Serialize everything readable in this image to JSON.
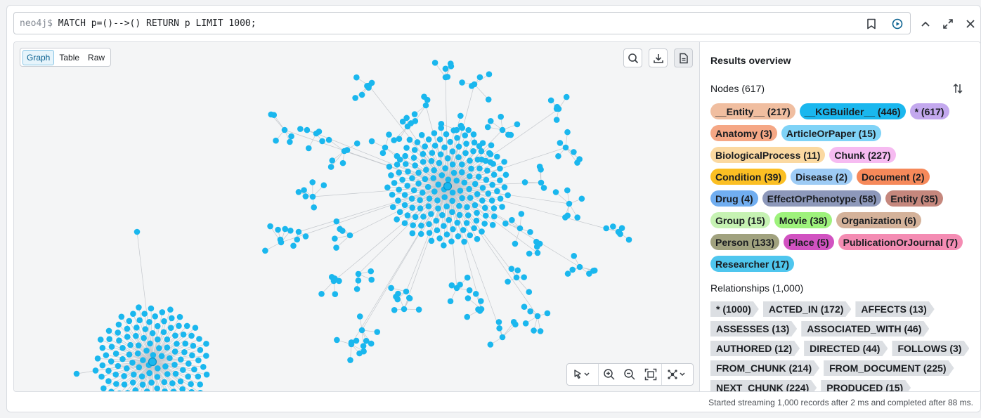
{
  "query": {
    "prompt": "neo4j$",
    "text": "MATCH p=()-->() RETURN p LIMIT 1000;"
  },
  "icons": {
    "bookmark": "bookmark-icon",
    "run": "run-icon",
    "collapse": "chevron-up-icon",
    "expand": "fullscreen-icon",
    "close": "close-icon",
    "search": "search-icon",
    "download": "download-icon",
    "details": "document-icon",
    "select": "pointer-icon",
    "zoom_in": "zoom-in-icon",
    "zoom_out": "zoom-out-icon",
    "fit": "fit-to-screen-icon",
    "layout": "layout-icon",
    "sort": "sort-icon"
  },
  "views": {
    "graph": "Graph",
    "table": "Table",
    "raw": "Raw",
    "active": "Graph"
  },
  "overview": {
    "title": "Results overview",
    "nodes_label": "Nodes (617)",
    "relationships_label": "Relationships (1,000)",
    "node_rows": [
      [
        {
          "label": "__Entity__ (217)",
          "color": "#f0bea0"
        },
        {
          "label": "__KGBuilder__ (446)",
          "color": "#1ab7ee"
        },
        {
          "label": "* (617)",
          "color": "#c3a8ee"
        }
      ],
      [
        {
          "label": "Anatomy (3)",
          "color": "#f5a785"
        },
        {
          "label": "ArticleOrPaper (15)",
          "color": "#7fd3f7"
        }
      ],
      [
        {
          "label": "BiologicalProcess (11)",
          "color": "#fbd9a1"
        },
        {
          "label": "Chunk (227)",
          "color": "#f6bbf1"
        }
      ],
      [
        {
          "label": "Condition (39)",
          "color": "#fbbf23"
        },
        {
          "label": "Disease (2)",
          "color": "#9dcbf5"
        },
        {
          "label": "Document (2)",
          "color": "#f6895a"
        }
      ],
      [
        {
          "label": "Drug (4)",
          "color": "#71aef0"
        },
        {
          "label": "EffectOrPhenotype (58)",
          "color": "#8d98ba"
        },
        {
          "label": "Entity (35)",
          "color": "#c5877d"
        }
      ],
      [
        {
          "label": "Group (15)",
          "color": "#c6f2b3"
        },
        {
          "label": "Movie (38)",
          "color": "#9ef27c"
        },
        {
          "label": "Organization (6)",
          "color": "#d4b29a"
        }
      ],
      [
        {
          "label": "Person (133)",
          "color": "#a1a27f"
        },
        {
          "label": "Place (5)",
          "color": "#d152c1"
        },
        {
          "label": "PublicationOrJournal (7)",
          "color": "#f48cb3"
        }
      ],
      [
        {
          "label": "Researcher (17)",
          "color": "#4fc6ee"
        }
      ]
    ],
    "relationship_rows": [
      [
        "* (1000)",
        "ACTED_IN (172)",
        "AFFECTS (13)"
      ],
      [
        "ASSESSES (13)",
        "ASSOCIATED_WITH (46)"
      ],
      [
        "AUTHORED (12)",
        "DIRECTED (44)",
        "FOLLOWS (3)"
      ],
      [
        "FROM_CHUNK (214)",
        "FROM_DOCUMENT (225)"
      ],
      [
        "NEXT_CHUNK (224)",
        "PRODUCED (15)"
      ]
    ]
  },
  "status": "Started streaming 1,000 records after 2 ms and completed after 88 ms.",
  "colors": {
    "node": "#1ab7ee",
    "edge": "#c4c8cd",
    "accent": "#0a6190"
  }
}
